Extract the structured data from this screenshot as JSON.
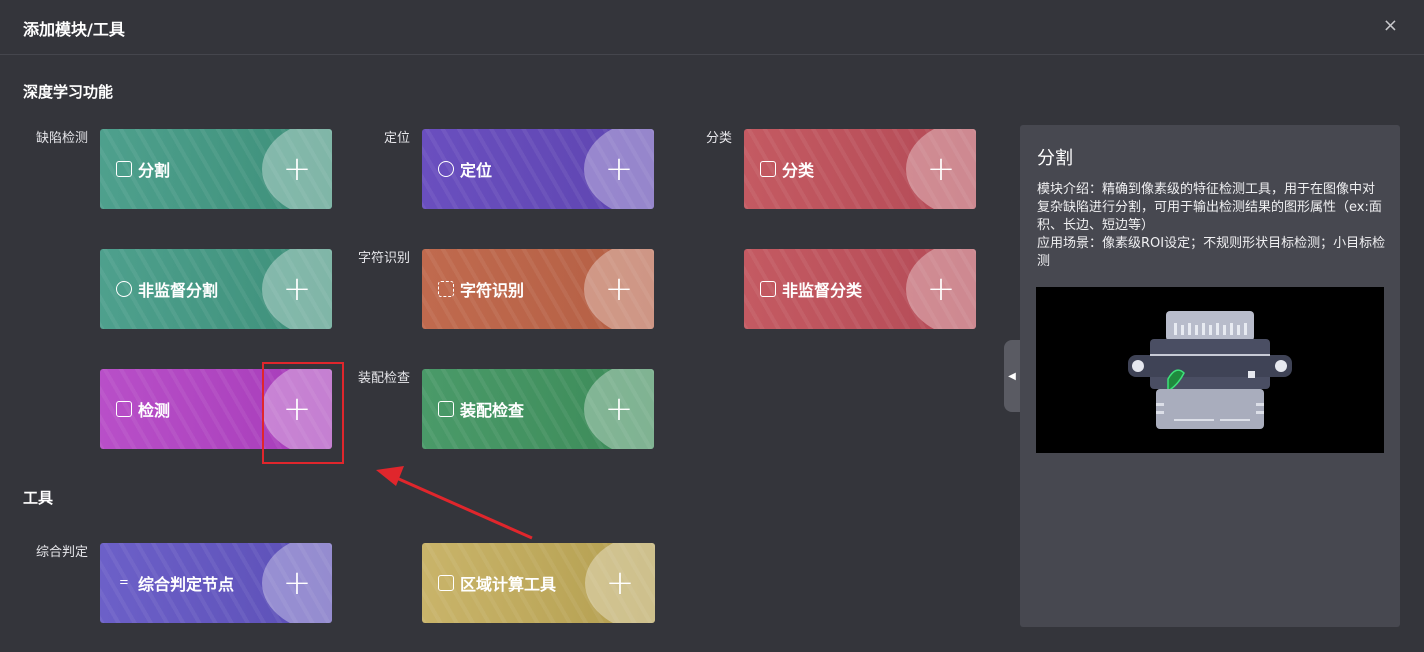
{
  "dialog": {
    "title": "添加模块/工具",
    "close_label": "×"
  },
  "sections": {
    "deep_learning": "深度学习功能",
    "tools": "工具"
  },
  "row_labels": {
    "defect": "缺陷检测",
    "locate": "定位",
    "classify": "分类",
    "ocr": "字符识别",
    "assembly": "装配检查",
    "judge": "综合判定"
  },
  "cards": {
    "segment": "分割",
    "locate": "定位",
    "classify": "分类",
    "unsup_segment": "非监督分割",
    "ocr": "字符识别",
    "unsup_classify": "非监督分类",
    "detect": "检测",
    "assembly": "装配检查",
    "judge_node": "综合判定节点",
    "area_calc": "区域计算工具",
    "plus": "+"
  },
  "panel": {
    "title": "分割",
    "intro": "模块介绍：精确到像素级的特征检测工具，用于在图像中对复杂缺陷进行分割，可用于输出检测结果的图形属性（ex:面积、长边、短边等）",
    "scenario": "应用场景：像素级ROI设定；不规则形状目标检测；小目标检测"
  },
  "colors": {
    "green": "#4ea08d",
    "purple": "#6a4fbf",
    "red": "#c45a62",
    "orange": "#c06a4e",
    "magenta": "#b84fc8",
    "assembly_green": "#4a9a69",
    "violet": "#6c60c8",
    "gold": "#c9b46a",
    "highlight": "#e0262c"
  }
}
